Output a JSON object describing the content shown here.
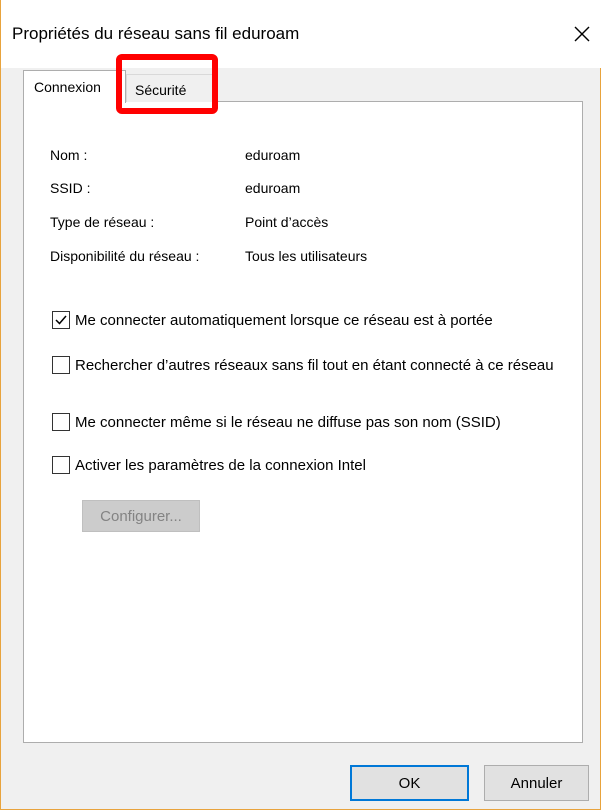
{
  "window": {
    "title": "Propriétés du réseau sans fil eduroam"
  },
  "tabs": [
    {
      "label": "Connexion",
      "selected": true
    },
    {
      "label": "Sécurité",
      "selected": false
    }
  ],
  "info": [
    {
      "label": "Nom :",
      "value": "eduroam"
    },
    {
      "label": "SSID :",
      "value": "eduroam"
    },
    {
      "label": "Type de réseau :",
      "value": "Point d’accès"
    },
    {
      "label": "Disponibilité du réseau :",
      "value": "Tous les utilisateurs"
    }
  ],
  "options": [
    {
      "label": "Me connecter automatiquement lorsque ce réseau est à portée",
      "checked": true
    },
    {
      "label": "Rechercher d’autres réseaux sans fil tout en étant connecté à ce réseau",
      "checked": false
    },
    {
      "label": "Me connecter même si le réseau ne diffuse pas son nom (SSID)",
      "checked": false
    },
    {
      "label": "Activer les paramètres de la connexion Intel",
      "checked": false
    }
  ],
  "configure_label": "Configurer...",
  "buttons": {
    "ok": "OK",
    "cancel": "Annuler"
  },
  "icons": {
    "close": "close-icon",
    "checkmark": "checkmark-icon"
  },
  "colors": {
    "highlight": "#ff0000",
    "default_button_border": "#0078d7",
    "window_border": "#e8a33d"
  }
}
